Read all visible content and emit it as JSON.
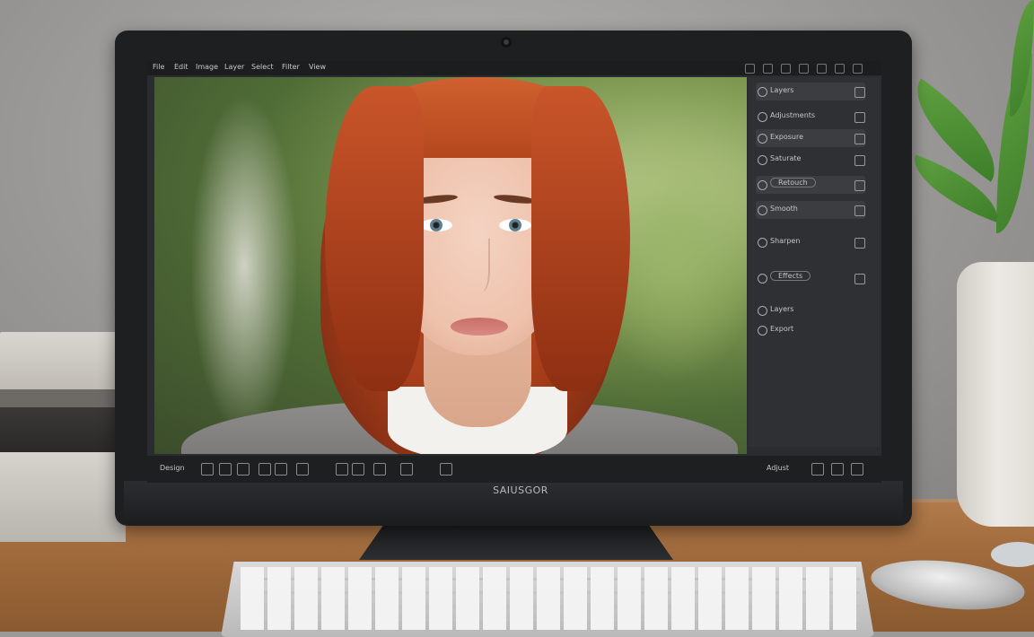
{
  "monitor": {
    "brand": "SAIUSGOR"
  },
  "app": {
    "menu": [
      "File",
      "Edit",
      "Image",
      "Layer",
      "Select",
      "Filter",
      "View"
    ],
    "panel": {
      "header": "Layers",
      "items": [
        {
          "label": "Adjustments",
          "selected": false
        },
        {
          "label": "Exposure",
          "selected": true
        },
        {
          "label": "Saturate",
          "selected": false
        },
        {
          "label": "Retouch",
          "selected": true,
          "field": true
        },
        {
          "label": "Smooth",
          "selected": false
        },
        {
          "label": "Sharpen",
          "selected": false
        },
        {
          "label": "Effects",
          "selected": false,
          "field": true
        },
        {
          "label": "Layers",
          "selected": false
        },
        {
          "label": "Export",
          "selected": false
        }
      ]
    },
    "bottombar": {
      "left_label": "Design",
      "right_label": "Adjust"
    }
  },
  "colors": {
    "hair": "#b4471e",
    "foliage": "#4f6b36",
    "app_bg": "#2b2c2f",
    "desk": "#a06a3c"
  }
}
